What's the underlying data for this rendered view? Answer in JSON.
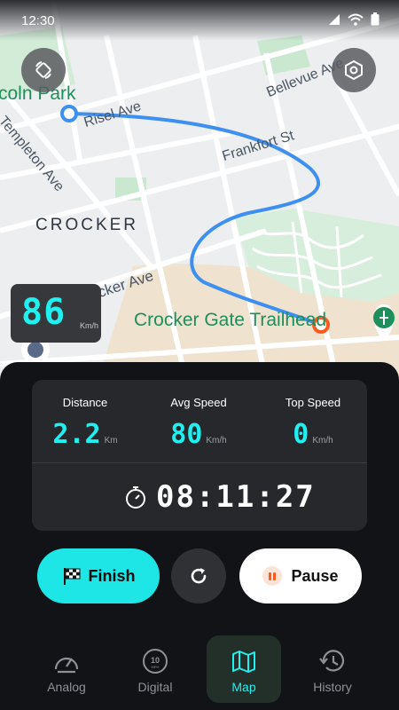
{
  "status": {
    "time": "12:30"
  },
  "map": {
    "labels": {
      "lincoln_park": "coln Park",
      "risel": "Risel Ave",
      "bellevue": "Bellevue Ave",
      "frankfort": "Frankfort St",
      "templeton": "Templeton Ave",
      "crocker": "CROCKER",
      "cker_ave": "cker Ave",
      "trailhead": "Crocker Gate Trailhead"
    },
    "route_color": "#3d8ff0",
    "end_marker_color": "#ff5a1f"
  },
  "speedometer": {
    "value": "86",
    "unit": "Km/h"
  },
  "stats": {
    "distance": {
      "label": "Distance",
      "value": "2.2",
      "unit": "Km"
    },
    "avg_speed": {
      "label": "Avg Speed",
      "value": "80",
      "unit": "Km/h"
    },
    "top_speed": {
      "label": "Top Speed",
      "value": "0",
      "unit": "Km/h"
    },
    "timer": "08:11:27"
  },
  "actions": {
    "finish": "Finish",
    "pause": "Pause"
  },
  "nav": {
    "items": [
      {
        "label": "Analog",
        "icon": "gauge-icon",
        "active": false
      },
      {
        "label": "Digital",
        "icon": "digital-speed-icon",
        "active": false
      },
      {
        "label": "Map",
        "icon": "map-icon",
        "active": true
      },
      {
        "label": "History",
        "icon": "history-icon",
        "active": false
      }
    ]
  },
  "colors": {
    "accent": "#1ee6e6",
    "panel": "#121316"
  }
}
